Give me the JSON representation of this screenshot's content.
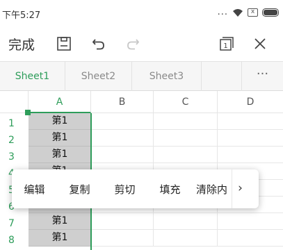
{
  "status_bar": {
    "time": "下午5:27",
    "dots": "...",
    "sim_icon_text": "x"
  },
  "toolbar": {
    "done_label": "完成",
    "icons": [
      "save-icon",
      "undo-icon",
      "redo-icon",
      "sheet-switch-icon",
      "close-icon"
    ],
    "sheet_switch_badge": "1"
  },
  "tabs": {
    "items": [
      {
        "label": "Sheet1",
        "active": true
      },
      {
        "label": "Sheet2",
        "active": false
      },
      {
        "label": "Sheet3",
        "active": false
      }
    ],
    "more": "···"
  },
  "grid": {
    "columns": [
      "A",
      "B",
      "C",
      "D"
    ],
    "rows": [
      {
        "num": "1",
        "a": "第1"
      },
      {
        "num": "2",
        "a": "第1"
      },
      {
        "num": "3",
        "a": "第1"
      },
      {
        "num": "4",
        "a": "第1"
      },
      {
        "num": "5",
        "a": "第1"
      },
      {
        "num": "6",
        "a": "第1"
      },
      {
        "num": "7",
        "a": "第1"
      },
      {
        "num": "8",
        "a": "第1"
      }
    ]
  },
  "context_menu": {
    "items": [
      "编辑",
      "复制",
      "剪切",
      "填充",
      "清除内"
    ],
    "arrow": "›"
  },
  "colors": {
    "accent": "#2e9d5a",
    "selection_fill": "#cfcfcf"
  }
}
